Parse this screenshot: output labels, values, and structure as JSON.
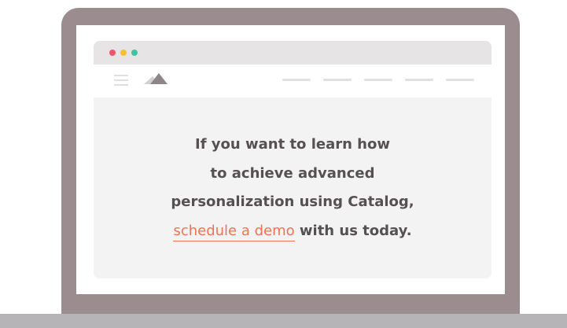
{
  "colors": {
    "laptop_frame": "#9a8c8f",
    "laptop_base": "#b7b4b8",
    "browser_chrome": "#e6e4e4",
    "content_bg": "#f3f3f3",
    "text": "#555052",
    "link": "#ee7450",
    "dot_red": "#f2546b",
    "dot_yellow": "#f2c230",
    "dot_green": "#3fc3a3"
  },
  "icons": {
    "menu": "hamburger-menu-icon",
    "logo": "mountain-logo-icon"
  },
  "message": {
    "line1": "If you want to learn how",
    "line2": "to achieve advanced",
    "line3": "personalization using Catalog,",
    "link_text": "schedule a demo",
    "line4_rest": " with us today."
  }
}
